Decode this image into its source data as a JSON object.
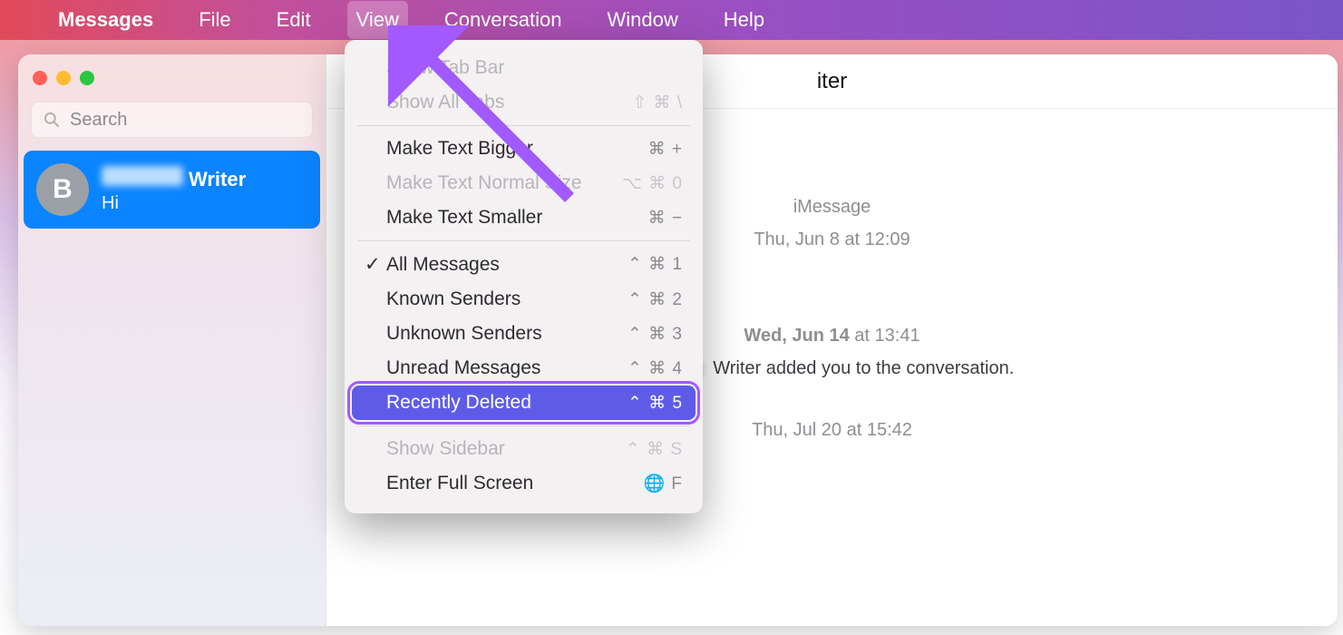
{
  "menubar": {
    "app": "Messages",
    "items": [
      "File",
      "Edit",
      "View",
      "Conversation",
      "Window",
      "Help"
    ],
    "active_index": 2
  },
  "sidebar": {
    "search_placeholder": "Search",
    "conversation": {
      "avatar_initial": "B",
      "name_visible": "Writer",
      "preview": "Hi"
    }
  },
  "main": {
    "title_visible": "iter",
    "service_label": "iMessage",
    "first_ts": "Thu, Jun 8 at 12:09",
    "event_ts": "Wed, Jun 14",
    "event_ts_tail": "at 13:41",
    "event_text_name_visible": "Writer",
    "event_text_tail": "added you to the conversation.",
    "second_ts": "Thu, Jul 20 at 15:42"
  },
  "dropdown": {
    "groups": [
      [
        {
          "label": "Show Tab Bar",
          "shortcut": "",
          "disabled": true
        },
        {
          "label": "Show All Tabs",
          "shortcut": "⇧ ⌘ \\",
          "disabled": true
        }
      ],
      [
        {
          "label": "Make Text Bigger",
          "shortcut": "⌘ +"
        },
        {
          "label": "Make Text Normal Size",
          "shortcut": "⌥ ⌘ 0",
          "disabled": true
        },
        {
          "label": "Make Text Smaller",
          "shortcut": "⌘ −"
        }
      ],
      [
        {
          "label": "All Messages",
          "shortcut": "⌃ ⌘ 1",
          "checked": true
        },
        {
          "label": "Known Senders",
          "shortcut": "⌃ ⌘ 2"
        },
        {
          "label": "Unknown Senders",
          "shortcut": "⌃ ⌘ 3"
        },
        {
          "label": "Unread Messages",
          "shortcut": "⌃ ⌘ 4"
        },
        {
          "label": "Recently Deleted",
          "shortcut": "⌃ ⌘ 5",
          "focus": true
        }
      ],
      [
        {
          "label": "Show Sidebar",
          "shortcut": "⌃ ⌘ S",
          "disabled": true
        },
        {
          "label": "Enter Full Screen",
          "shortcut": "🌐 F"
        }
      ]
    ]
  }
}
